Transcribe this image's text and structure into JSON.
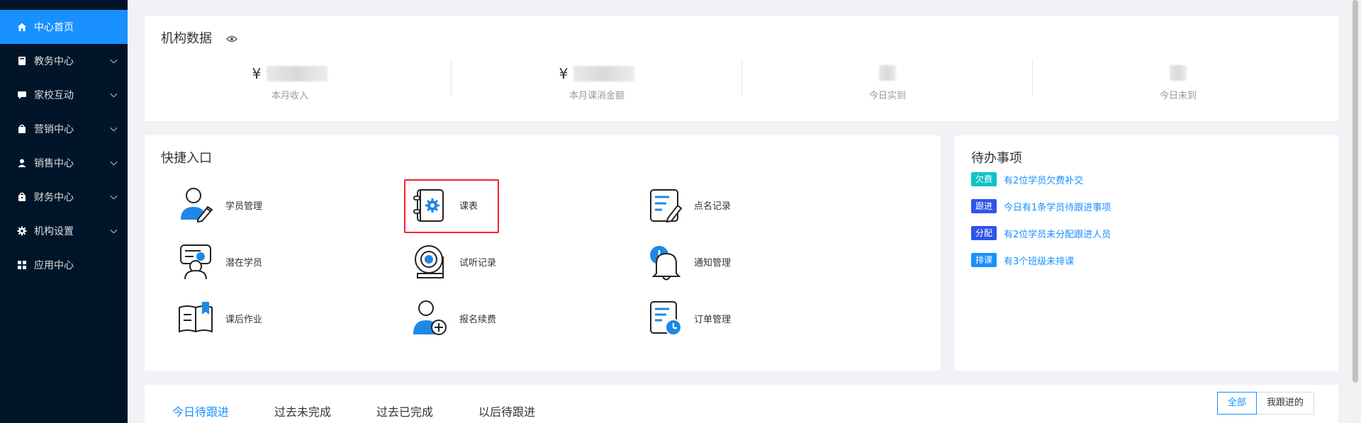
{
  "sidebar": {
    "items": [
      {
        "label": "中心首页",
        "icon": "home-icon",
        "active": true
      },
      {
        "label": "教务中心",
        "icon": "book-icon"
      },
      {
        "label": "家校互动",
        "icon": "chat-icon"
      },
      {
        "label": "营销中心",
        "icon": "bag-icon"
      },
      {
        "label": "销售中心",
        "icon": "user-icon"
      },
      {
        "label": "财务中心",
        "icon": "wallet-icon"
      },
      {
        "label": "机构设置",
        "icon": "gear-icon"
      },
      {
        "label": "应用中心",
        "icon": "grid-icon"
      }
    ]
  },
  "stats": {
    "title": "机构数据",
    "currency": "¥",
    "items": [
      {
        "label": "本月收入"
      },
      {
        "label": "本月课消金额"
      },
      {
        "label": "今日实到"
      },
      {
        "label": "今日未到"
      }
    ]
  },
  "quick": {
    "title": "快捷入口",
    "items": [
      {
        "label": "学员管理",
        "icon": "student-edit-icon"
      },
      {
        "label": "课表",
        "icon": "schedule-gear-icon",
        "highlighted": true
      },
      {
        "label": "点名记录",
        "icon": "roll-call-icon"
      },
      {
        "label": "潜在学员",
        "icon": "potential-student-icon"
      },
      {
        "label": "试听记录",
        "icon": "trial-record-icon"
      },
      {
        "label": "通知管理",
        "icon": "bell-clock-icon"
      },
      {
        "label": "课后作业",
        "icon": "homework-book-icon"
      },
      {
        "label": "报名续费",
        "icon": "enroll-add-icon"
      },
      {
        "label": "订单管理",
        "icon": "order-clock-icon"
      }
    ]
  },
  "todo": {
    "title": "待办事项",
    "items": [
      {
        "tag": "欠费",
        "text": "有2位学员欠费补交",
        "color": "#13c2c2"
      },
      {
        "tag": "跟进",
        "text": "今日有1条学员待跟进事项",
        "color": "#2f54eb"
      },
      {
        "tag": "分配",
        "text": "有2位学员未分配跟进人员",
        "color": "#2f54eb"
      },
      {
        "tag": "排课",
        "text": "有3个班级未排课",
        "color": "#1890ff"
      }
    ]
  },
  "followup": {
    "tabs": [
      "今日待跟进",
      "过去未完成",
      "过去已完成",
      "以后待跟进"
    ],
    "filters": [
      "全部",
      "我跟进的"
    ]
  },
  "colors": {
    "primary": "#1890ff",
    "sidebar": "#001529",
    "highlight": "#f5222d"
  }
}
